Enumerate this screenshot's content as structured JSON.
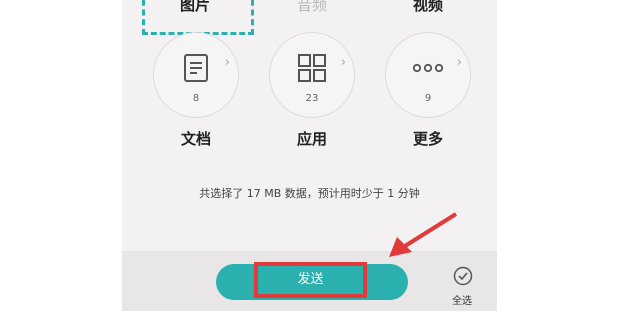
{
  "top_row": {
    "images_label": "图片",
    "audio_label": "音频",
    "video_label": "视频"
  },
  "categories": [
    {
      "label": "文档",
      "count": "8",
      "icon": "document-icon"
    },
    {
      "label": "应用",
      "count": "23",
      "icon": "apps-grid-icon"
    },
    {
      "label": "更多",
      "count": "9",
      "icon": "more-dots-icon"
    }
  ],
  "summary": "共选择了 17 MB 数据，预计用时少于 1 分钟",
  "footer": {
    "send_label": "发送",
    "select_all_label": "全选"
  },
  "colors": {
    "accent": "#2ab0ae",
    "highlight": "#e03a3a"
  }
}
